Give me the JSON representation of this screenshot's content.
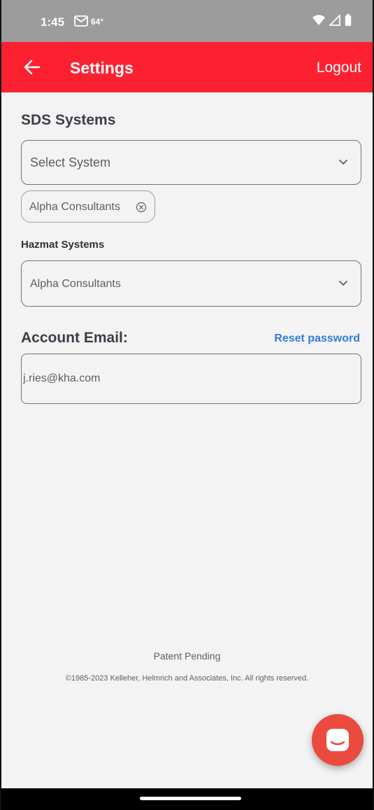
{
  "status_bar": {
    "time": "1:45",
    "mail_icon": "gmail-icon",
    "temperature": "64°",
    "icons": [
      "wifi-icon",
      "signal-icon",
      "battery-icon"
    ]
  },
  "app_bar": {
    "title": "Settings",
    "back_icon": "arrow-left-icon",
    "logout_label": "Logout",
    "color": "#fc2130"
  },
  "sds_systems": {
    "title": "SDS Systems",
    "placeholder": "Select System",
    "selected_chips": [
      {
        "label": "Alpha Consultants"
      }
    ]
  },
  "hazmat_systems": {
    "title": "Hazmat Systems",
    "selected_value": "Alpha Consultants"
  },
  "account": {
    "title": "Account Email:",
    "reset_label": "Reset password",
    "email_value": "j.ries@kha.com",
    "link_color": "#2f7de1"
  },
  "footer": {
    "patent": "Patent Pending",
    "copyright": "©1985-2023 Kelleher, Helmrich and Associates, Inc. All rights reserved."
  },
  "fab": {
    "icon": "chat-icon",
    "color": "#eb4a3f"
  }
}
